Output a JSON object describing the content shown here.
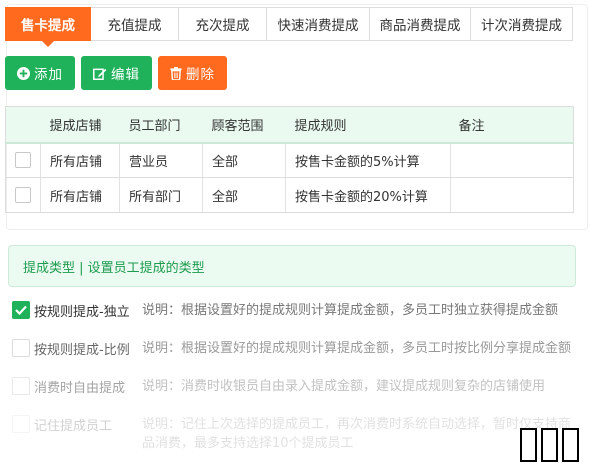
{
  "tabs": [
    {
      "label": "售卡提成",
      "active": true
    },
    {
      "label": "充值提成",
      "active": false
    },
    {
      "label": "充次提成",
      "active": false
    },
    {
      "label": "快速消费提成",
      "active": false
    },
    {
      "label": "商品消费提成",
      "active": false
    },
    {
      "label": "计次消费提成",
      "active": false
    }
  ],
  "toolbar": {
    "add_label": "添加",
    "edit_label": "编辑",
    "delete_label": "删除"
  },
  "table": {
    "headers": [
      "提成店铺",
      "员工部门",
      "顾客范围",
      "提成规则",
      "备注"
    ],
    "rows": [
      [
        "所有店铺",
        "营业员",
        "全部",
        "按售卡金额的5%计算",
        ""
      ],
      [
        "所有店铺",
        "所有部门",
        "全部",
        "按售卡金额的20%计算",
        ""
      ]
    ]
  },
  "info": {
    "title": "提成类型 | 设置员工提成的类型"
  },
  "options": [
    {
      "label": "按规则提成-独立",
      "checked": true,
      "desc": "说明：根据设置好的提成规则计算提成金额，多员工时独立获得提成金额"
    },
    {
      "label": "按规则提成-比例",
      "checked": false,
      "desc": "说明：根据设置好的提成规则计算提成金额，多员工时按比例分享提成金额"
    },
    {
      "label": "消费时自由提成",
      "checked": false,
      "desc": "说明：消费时收银员自由录入提成金额，建议提成规则复杂的店铺使用"
    },
    {
      "label": "记住提成员工",
      "checked": false,
      "desc": "说明：记住上次选择的提成员工，再次消费时系统自动选择，暂时仅支持商品消费，最多支持选择10个提成员工"
    }
  ],
  "colors": {
    "accent_orange": "#ff6a1f",
    "accent_green": "#1fb25a",
    "info_bg": "#ecfbf1"
  }
}
